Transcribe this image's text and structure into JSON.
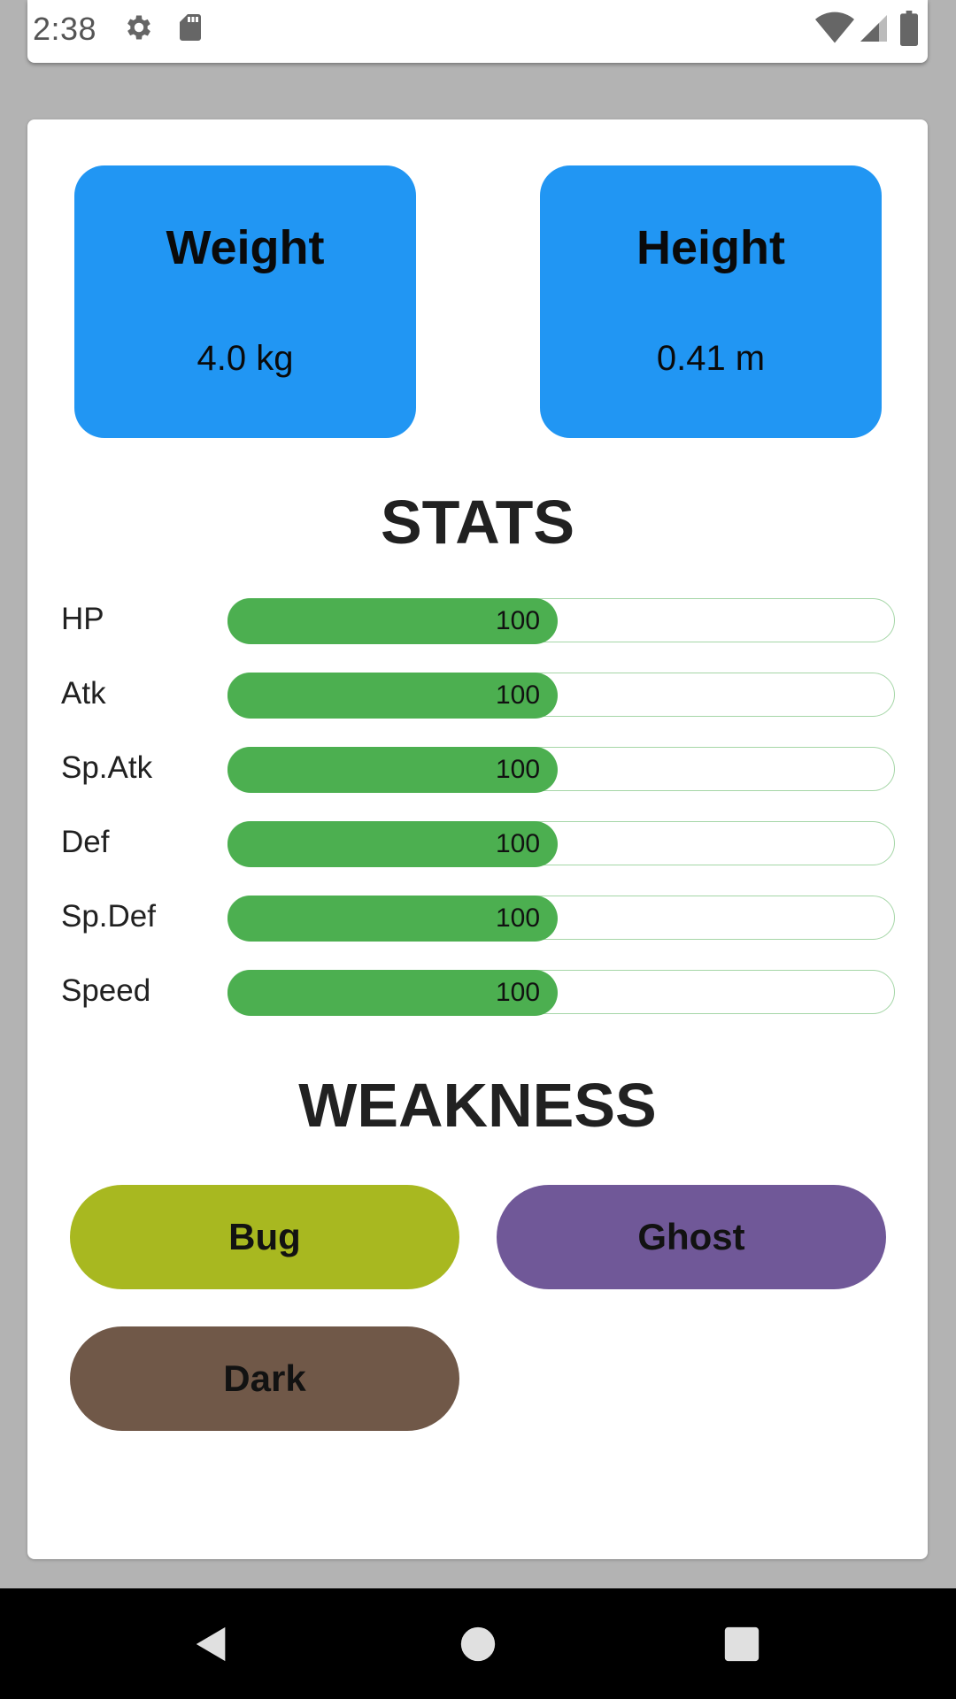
{
  "status_bar": {
    "time": "2:38",
    "icons": [
      "gear-icon",
      "sd-card-icon",
      "wifi-icon",
      "cell-signal-icon",
      "battery-icon"
    ]
  },
  "info": {
    "weight": {
      "label": "Weight",
      "value": "4.0 kg"
    },
    "height": {
      "label": "Height",
      "value": "0.41 m"
    },
    "tile_color": "#2196f3"
  },
  "stats": {
    "title": "STATS",
    "bar_color": "#4caf50",
    "items": [
      {
        "label": "HP",
        "value": "100",
        "fill_fraction": 0.5
      },
      {
        "label": "Atk",
        "value": "100",
        "fill_fraction": 0.5
      },
      {
        "label": "Sp.Atk",
        "value": "100",
        "fill_fraction": 0.5
      },
      {
        "label": "Def",
        "value": "100",
        "fill_fraction": 0.5
      },
      {
        "label": "Sp.Def",
        "value": "100",
        "fill_fraction": 0.5
      },
      {
        "label": "Speed",
        "value": "100",
        "fill_fraction": 0.5
      }
    ]
  },
  "weakness": {
    "title": "WEAKNESS",
    "types": [
      {
        "label": "Bug",
        "color": "#a8b820"
      },
      {
        "label": "Ghost",
        "color": "#705898"
      },
      {
        "label": "Dark",
        "color": "#705848"
      }
    ]
  },
  "nav_bar": {
    "icons": [
      "back-icon",
      "home-icon",
      "recents-icon"
    ]
  }
}
